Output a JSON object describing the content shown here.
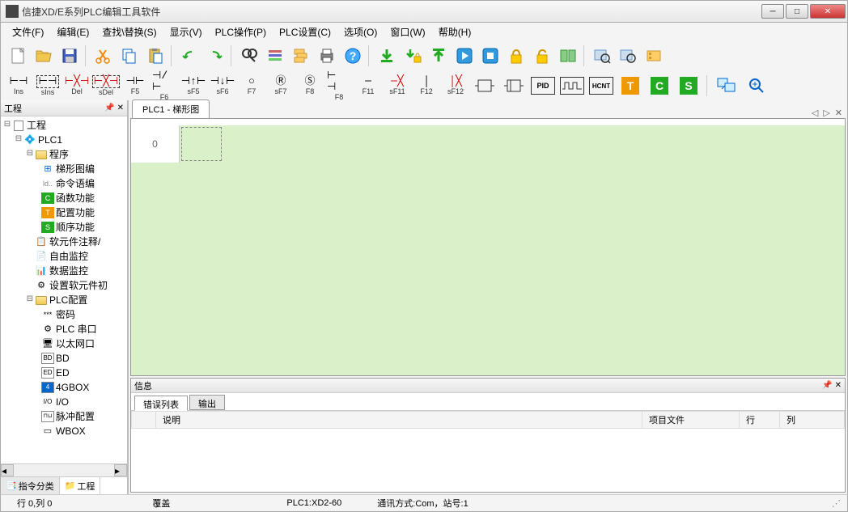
{
  "title": "信捷XD/E系列PLC编辑工具软件",
  "menu": {
    "file": "文件(F)",
    "edit": "编辑(E)",
    "find": "查找\\替换(S)",
    "view": "显示(V)",
    "plcop": "PLC操作(P)",
    "plcset": "PLC设置(C)",
    "option": "选项(O)",
    "window": "窗口(W)",
    "help": "帮助(H)"
  },
  "ladder_buttons": {
    "ins": "Ins",
    "sins": "sIns",
    "del": "Del",
    "sdel": "sDel",
    "f5": "F5",
    "f6": "F6",
    "sf5": "sF5",
    "sf6": "sF6",
    "f7": "F7",
    "sf7": "sF7",
    "f8": "F8",
    "f11": "F11",
    "sf11": "sF11",
    "f12": "F12",
    "sf12": "sF12",
    "pid": "PID",
    "hcnt": "HCNT"
  },
  "tree": {
    "title": "工程",
    "root": "工程",
    "plc1": "PLC1",
    "program": "程序",
    "ladder": "梯形图编",
    "instr": "命令语编",
    "func": "函数功能",
    "config": "配置功能",
    "seq": "顺序功能",
    "comment": "软元件注释/",
    "freemon": "自由监控",
    "datamon": "数据监控",
    "softset": "设置软元件初",
    "plcconfig": "PLC配置",
    "password": "密码",
    "plcserial": "PLC 串口",
    "ethernet": "以太网口",
    "bd": "BD",
    "ed": "ED",
    "gbox": "4GBOX",
    "io": "I/O",
    "pulse": "脉冲配置",
    "wbox": "WBOX",
    "tab1": "指令分类",
    "tab2": "工程"
  },
  "editor": {
    "tab": "PLC1 - 梯形图",
    "rownum": "0"
  },
  "info": {
    "title": "信息",
    "tab1": "错误列表",
    "tab2": "输出",
    "col1": "说明",
    "col2": "项目文件",
    "col3": "行",
    "col4": "列"
  },
  "status": {
    "cursor": "行 0,列 0",
    "mode": "覆盖",
    "plc": "PLC1:XD2-60",
    "comm": "通讯方式:Com，站号:1"
  }
}
